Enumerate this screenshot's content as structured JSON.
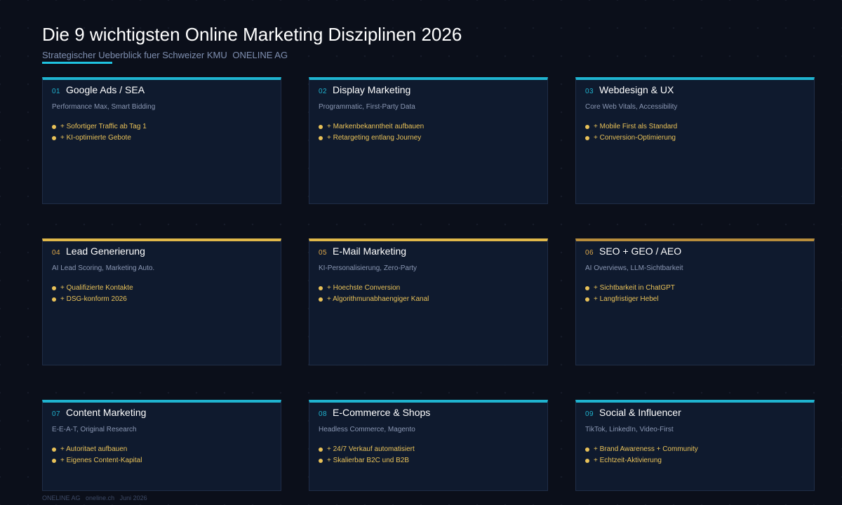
{
  "header": {
    "title": "Die 9 wichtigsten Online Marketing Disziplinen 2026",
    "subtitle": "Strategischer Ueberblick fuer Schweizer KMU",
    "brand": "ONELINE AG"
  },
  "colors": {
    "accent_cyan": "#1fb3cf",
    "accent_gold": "#e0b84a",
    "benefit_text": "#e8c158",
    "background": "#0b0f1a",
    "card_background": "#0f1a2e"
  },
  "cards": [
    {
      "number": "01",
      "title": "Google Ads / SEA",
      "subtitle": "Performance Max, Smart Bidding",
      "benefits": [
        "+ Sofortiger Traffic ab Tag 1",
        "+ KI-optimierte Gebote"
      ]
    },
    {
      "number": "02",
      "title": "Display Marketing",
      "subtitle": "Programmatic, First-Party Data",
      "benefits": [
        "+ Markenbekanntheit aufbauen",
        "+ Retargeting entlang Journey"
      ]
    },
    {
      "number": "03",
      "title": "Webdesign & UX",
      "subtitle": "Core Web Vitals, Accessibility",
      "benefits": [
        "+ Mobile First als Standard",
        "+ Conversion-Optimierung"
      ]
    },
    {
      "number": "04",
      "title": "Lead Generierung",
      "subtitle": "AI Lead Scoring, Marketing Auto.",
      "benefits": [
        "+ Qualifizierte Kontakte",
        "+ DSG-konform 2026"
      ]
    },
    {
      "number": "05",
      "title": "E-Mail Marketing",
      "subtitle": "KI-Personalisierung, Zero-Party",
      "benefits": [
        "+ Hoechste Conversion",
        "+ Algorithmunabhaengiger Kanal"
      ]
    },
    {
      "number": "06",
      "title": "SEO + GEO / AEO",
      "subtitle": "AI Overviews, LLM-Sichtbarkeit",
      "benefits": [
        "+ Sichtbarkeit in ChatGPT",
        "+ Langfristiger Hebel"
      ]
    },
    {
      "number": "07",
      "title": "Content Marketing",
      "subtitle": "E-E-A-T, Original Research",
      "benefits": [
        "+ Autoritaet aufbauen",
        "+ Eigenes Content-Kapital"
      ]
    },
    {
      "number": "08",
      "title": "E-Commerce & Shops",
      "subtitle": "Headless Commerce, Magento",
      "benefits": [
        "+ 24/7 Verkauf automatisiert",
        "+ Skalierbar B2C und B2B"
      ]
    },
    {
      "number": "09",
      "title": "Social & Influencer",
      "subtitle": "TikTok, LinkedIn, Video-First",
      "benefits": [
        "+ Brand Awareness + Community",
        "+ Echtzeit-Aktivierung"
      ]
    }
  ],
  "footer": {
    "company": "ONELINE AG",
    "website": "oneline.ch",
    "date": "Juni 2026"
  }
}
